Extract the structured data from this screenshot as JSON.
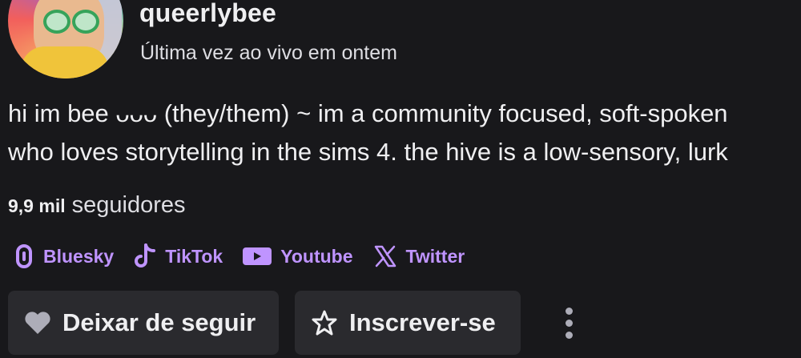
{
  "channel": {
    "username": "queerlybee",
    "last_live": "Última vez ao vivo em ontem",
    "bio_line1": "hi im bee ᴗᴗᴗ (they/them) ~ im a community focused, soft-spoken",
    "bio_line2": "who loves storytelling in the sims 4. the hive is a low-sensory, lurk",
    "followers_count": "9,9 mil",
    "followers_label": "seguidores"
  },
  "socials": [
    {
      "label": "Bluesky",
      "icon": "bluesky-icon"
    },
    {
      "label": "TikTok",
      "icon": "tiktok-icon"
    },
    {
      "label": "Youtube",
      "icon": "youtube-icon"
    },
    {
      "label": "Twitter",
      "icon": "x-icon"
    }
  ],
  "actions": {
    "unfollow_label": "Deixar de seguir",
    "subscribe_label": "Inscrever-se"
  },
  "colors": {
    "accent": "#bf94ff",
    "background": "#18181b",
    "button": "#2a2a2e"
  }
}
